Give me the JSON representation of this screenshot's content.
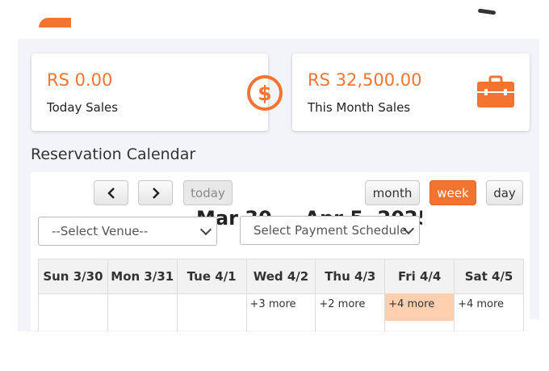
{
  "cards": {
    "today": {
      "amount": "RS 0.00",
      "label": "Today Sales",
      "icon": "dollar-circle-icon",
      "color": "#f27430"
    },
    "month": {
      "amount": "RS 32,500.00",
      "label": "This Month Sales",
      "icon": "briefcase-icon",
      "color": "#f27430"
    }
  },
  "section_title": "Reservation Calendar",
  "toolbar": {
    "prev_label": "‹",
    "next_label": "›",
    "today_label": "today",
    "month_label": "month",
    "week_label": "week",
    "day_label": "day",
    "active_view": "week"
  },
  "calendar_title": "Mar 30 — Apr 5, 2025",
  "filters": {
    "venue": "--Select Venue--",
    "schedule": "Select Payment Schedule"
  },
  "days": [
    {
      "header": "Sun 3/30",
      "more": ""
    },
    {
      "header": "Mon 3/31",
      "more": ""
    },
    {
      "header": "Tue 4/1",
      "more": ""
    },
    {
      "header": "Wed 4/2",
      "more": "+3 more"
    },
    {
      "header": "Thu 4/3",
      "more": "+2 more"
    },
    {
      "header": "Fri 4/4",
      "more": "+4 more"
    },
    {
      "header": "Sat 4/5",
      "more": "+4 more"
    }
  ],
  "colors": {
    "accent": "#f27430",
    "today_highlight": "#ffd0b0"
  }
}
